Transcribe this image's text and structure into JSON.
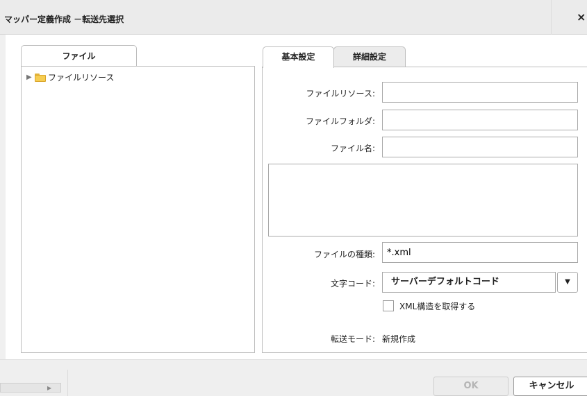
{
  "window": {
    "title": "マッパー定義作成 －転送先選択",
    "close_label": "×"
  },
  "left_panel": {
    "tab_label": "ファイル",
    "tree": [
      {
        "label": "ファイルリソース",
        "icon": "folder-icon",
        "expanded": false
      }
    ]
  },
  "right_panel": {
    "tabs": [
      {
        "label": "基本設定",
        "active": true
      },
      {
        "label": "詳細設定",
        "active": false
      }
    ],
    "fields": {
      "file_resource": {
        "label": "ファイルリソース:",
        "value": ""
      },
      "file_folder": {
        "label": "ファイルフォルダ:",
        "value": ""
      },
      "file_name": {
        "label": "ファイル名:",
        "value": ""
      },
      "file_type": {
        "label": "ファイルの種類:",
        "value": "*.xml"
      },
      "encoding": {
        "label": "文字コード:",
        "value": "サーバーデフォルトコード"
      },
      "xml_structure": {
        "label": "XML構造を取得する",
        "checked": false
      },
      "transfer_mode": {
        "label": "転送モード:",
        "value": "新規作成"
      }
    }
  },
  "footer": {
    "ok_label": "OK",
    "cancel_label": "キャンセル",
    "scroll_arrow": "▶"
  }
}
